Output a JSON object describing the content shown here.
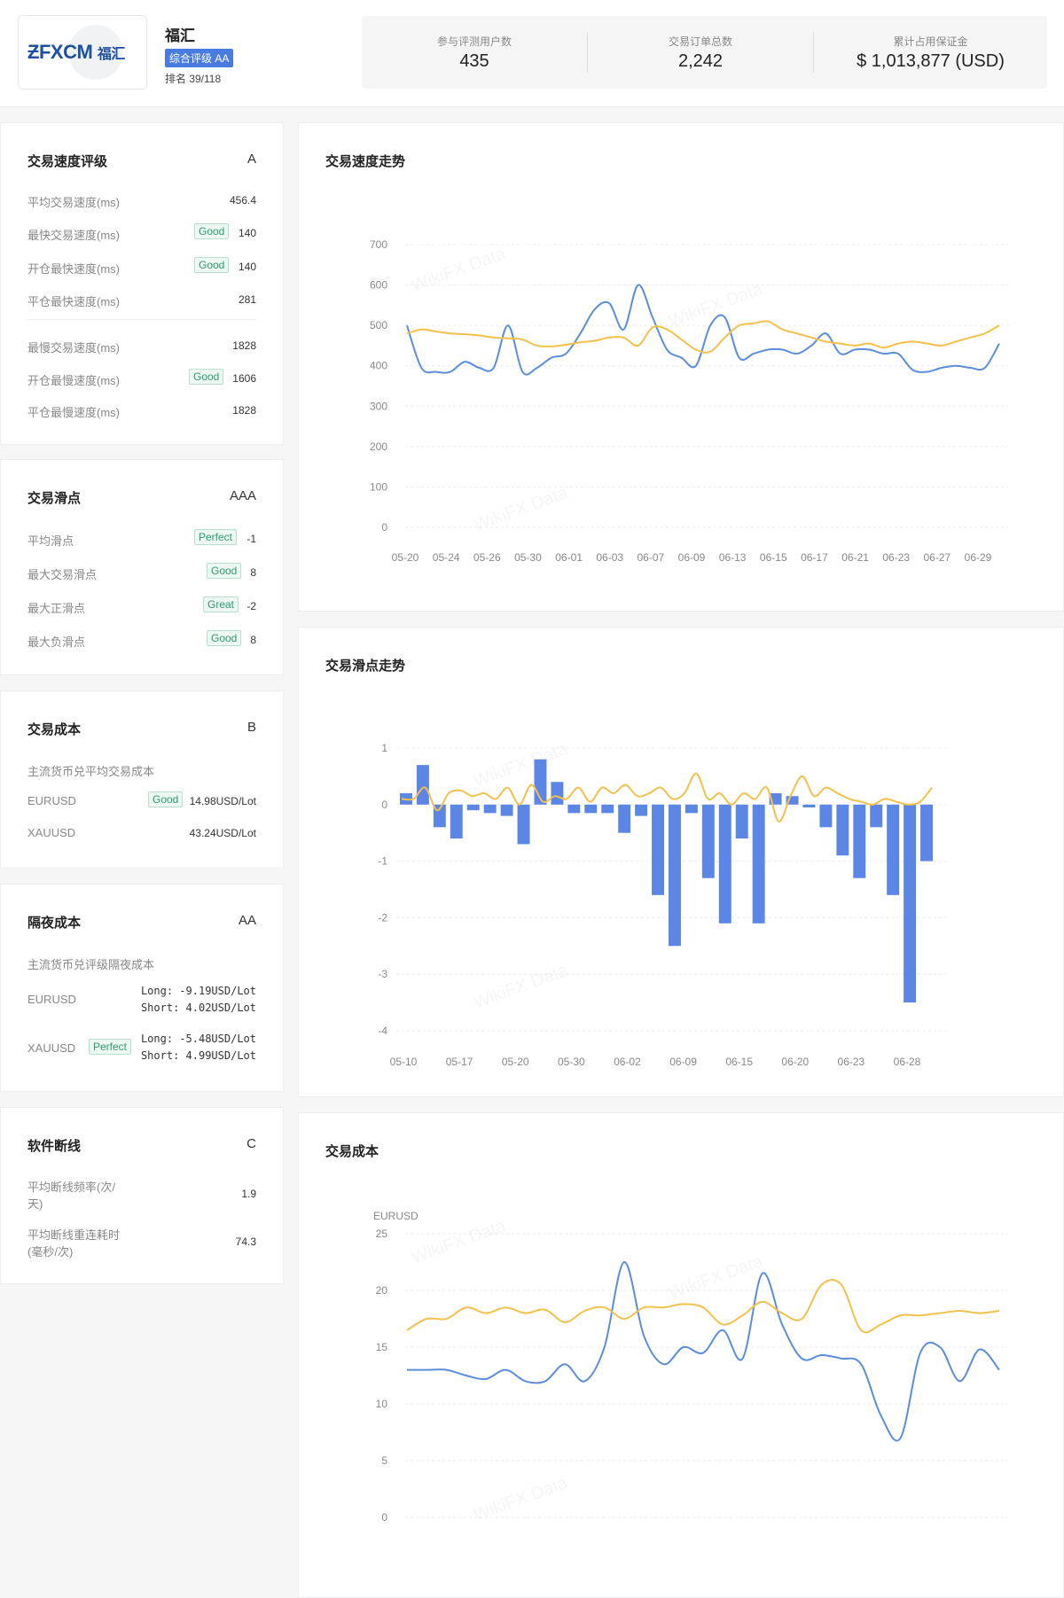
{
  "header": {
    "logo_text": "FXCM",
    "logo_cn": "福汇",
    "broker_name": "福汇",
    "rating_badge": "综合评级 AA",
    "rank": "排名 39/118",
    "stats": [
      {
        "label": "参与评测用户数",
        "value": "435"
      },
      {
        "label": "交易订单总数",
        "value": "2,242"
      },
      {
        "label": "累计占用保证金",
        "value": "$ 1,013,877 (USD)"
      }
    ]
  },
  "speed": {
    "title": "交易速度评级",
    "grade": "A",
    "rows": [
      {
        "label": "平均交易速度(ms)",
        "tag": "",
        "value": "456.4"
      },
      {
        "label": "最快交易速度(ms)",
        "tag": "Good",
        "value": "140"
      },
      {
        "label": "开仓最快速度(ms)",
        "tag": "Good",
        "value": "140"
      },
      {
        "label": "平仓最快速度(ms)",
        "tag": "",
        "value": "281"
      },
      {
        "label": "最慢交易速度(ms)",
        "tag": "",
        "value": "1828"
      },
      {
        "label": "开仓最慢速度(ms)",
        "tag": "Good",
        "value": "1606"
      },
      {
        "label": "平仓最慢速度(ms)",
        "tag": "",
        "value": "1828"
      }
    ]
  },
  "slippage": {
    "title": "交易滑点",
    "grade": "AAA",
    "rows": [
      {
        "label": "平均滑点",
        "tag": "Perfect",
        "value": "-1"
      },
      {
        "label": "最大交易滑点",
        "tag": "Good",
        "value": "8"
      },
      {
        "label": "最大正滑点",
        "tag": "Great",
        "value": "-2"
      },
      {
        "label": "最大负滑点",
        "tag": "Good",
        "value": "8"
      }
    ]
  },
  "cost": {
    "title": "交易成本",
    "grade": "B",
    "subtitle": "主流货币兑平均交易成本",
    "rows": [
      {
        "label": "EURUSD",
        "tag": "Good",
        "value": "14.98USD/Lot"
      },
      {
        "label": "XAUUSD",
        "tag": "",
        "value": "43.24USD/Lot"
      }
    ]
  },
  "overnight": {
    "title": "隔夜成本",
    "grade": "AA",
    "subtitle": "主流货币兑评级隔夜成本",
    "rows": [
      {
        "label": "EURUSD",
        "tag": "",
        "long": "Long: -9.19USD/Lot",
        "short": "Short: 4.02USD/Lot"
      },
      {
        "label": "XAUUSD",
        "tag": "Perfect",
        "long": "Long: -5.48USD/Lot",
        "short": "Short: 4.99USD/Lot"
      }
    ]
  },
  "disconnect": {
    "title": "软件断线",
    "grade": "C",
    "rows": [
      {
        "label1": "平均断线频率(次/",
        "label2": "天)",
        "value": "1.9"
      },
      {
        "label1": "平均断线重连耗时",
        "label2": "(毫秒/次)",
        "value": "74.3"
      }
    ]
  },
  "watermark": "WikiFX Data",
  "colors": {
    "blue": "#5b8ddb",
    "yellow": "#f2c14b",
    "bar": "#5b86e5",
    "grid": "#ececec",
    "axis_text": "#888888"
  },
  "chart_data": [
    {
      "type": "line",
      "title": "交易速度走势",
      "x_ticks": [
        "05-20",
        "05-24",
        "05-26",
        "05-30",
        "06-01",
        "06-03",
        "06-07",
        "06-09",
        "06-13",
        "06-15",
        "06-17",
        "06-21",
        "06-23",
        "06-27",
        "06-29"
      ],
      "ylim": [
        0,
        700
      ],
      "y_ticks": [
        0,
        100,
        200,
        300,
        400,
        500,
        600,
        700
      ],
      "series": [
        {
          "color": "#5b8ddb",
          "values": [
            500,
            395,
            385,
            385,
            410,
            395,
            395,
            500,
            385,
            395,
            420,
            430,
            480,
            540,
            555,
            490,
            600,
            520,
            440,
            420,
            400,
            500,
            520,
            420,
            430,
            440,
            440,
            430,
            450,
            480,
            430,
            440,
            440,
            430,
            430,
            390,
            385,
            395,
            400,
            395,
            395,
            455
          ]
        },
        {
          "color": "#f2c14b",
          "values": [
            480,
            490,
            485,
            480,
            478,
            475,
            470,
            468,
            465,
            450,
            448,
            452,
            458,
            462,
            470,
            470,
            450,
            495,
            490,
            465,
            440,
            435,
            470,
            500,
            505,
            510,
            490,
            480,
            470,
            460,
            455,
            450,
            455,
            445,
            455,
            460,
            455,
            450,
            460,
            470,
            480,
            500
          ]
        }
      ]
    },
    {
      "type": "bar",
      "title": "交易滑点走势",
      "x_ticks": [
        "05-10",
        "05-17",
        "05-20",
        "05-30",
        "06-02",
        "06-09",
        "06-15",
        "06-20",
        "06-23",
        "06-28"
      ],
      "ylim": [
        -4,
        1
      ],
      "y_ticks": [
        1,
        0,
        -1,
        -2,
        -3,
        -4
      ],
      "series": [
        {
          "name": "bars",
          "color": "#5b86e5",
          "values": [
            0.2,
            0.7,
            -0.4,
            -0.6,
            -0.1,
            -0.15,
            -0.2,
            -0.7,
            0.8,
            0.4,
            -0.15,
            -0.15,
            -0.15,
            -0.5,
            -0.2,
            -1.6,
            -2.5,
            -0.15,
            -1.3,
            -2.1,
            -0.6,
            -2.1,
            0.2,
            0.15,
            -0.05,
            -0.4,
            -0.9,
            -1.3,
            -0.4,
            -1.6,
            -3.5,
            -1.0
          ]
        },
        {
          "name": "line",
          "color": "#f2c14b",
          "values": [
            0.1,
            0.1,
            0.3,
            -0.1,
            0.2,
            0.25,
            0.15,
            0.2,
            0.1,
            0.3,
            0.0,
            0.35,
            0.05,
            0.15,
            0.1,
            0.3,
            0.05,
            0.3,
            0.2,
            0.35,
            0.15,
            0.2,
            0.3,
            0.1,
            0.2,
            0.55,
            0.1,
            0.2,
            0.0,
            0.2,
            0.1,
            0.3,
            -0.3,
            0.15,
            0.5,
            0.15,
            0.3,
            0.2,
            0.1,
            0.05,
            0.0,
            0.1,
            0.05,
            0.0,
            0.05,
            0.3
          ]
        }
      ]
    },
    {
      "type": "line",
      "title": "交易成本",
      "y_label": "EURUSD",
      "ylim": [
        0,
        25
      ],
      "y_ticks": [
        0,
        5,
        10,
        15,
        20,
        25
      ],
      "series": [
        {
          "color": "#5b8ddb",
          "values": [
            13,
            13,
            13,
            12.5,
            12.2,
            13,
            12,
            12,
            13.5,
            12,
            15,
            22.5,
            16,
            13.5,
            15,
            14.5,
            16.5,
            14,
            21.5,
            17,
            14,
            14.3,
            14,
            13.5,
            9,
            7,
            14.5,
            15,
            12,
            14.8,
            13
          ]
        },
        {
          "color": "#f2c14b",
          "values": [
            16.5,
            17.5,
            17.5,
            18.5,
            18,
            18.5,
            18,
            18.3,
            17.2,
            18.2,
            18.5,
            17.5,
            18.5,
            18.5,
            18.8,
            18.5,
            17,
            17.8,
            19,
            18,
            17.5,
            20.5,
            20.5,
            16.5,
            17,
            17.8,
            17.8,
            18,
            18.2,
            18,
            18.2
          ]
        }
      ]
    }
  ]
}
